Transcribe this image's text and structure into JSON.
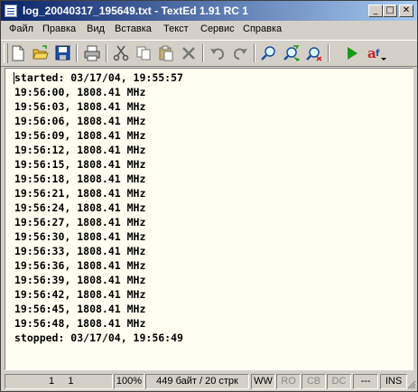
{
  "window": {
    "title": "log_20040317_195649.txt - TextEd 1.91 RC 1",
    "controls": {
      "minimize": "_",
      "maximize": "□",
      "close": "✕"
    }
  },
  "menu": [
    "Файл",
    "Правка",
    "Вид",
    "Вставка",
    "Текст",
    "Сервис",
    "Справка"
  ],
  "toolbar": {
    "icons": [
      "new-file-icon",
      "open-folder-icon",
      "save-icon",
      "print-icon",
      "cut-icon",
      "copy-icon",
      "paste-icon",
      "delete-icon",
      "undo-icon",
      "redo-icon",
      "find-icon",
      "find-next-icon",
      "replace-icon",
      "run-icon",
      "font-icon"
    ],
    "colors": {
      "green": "#1a9a1a",
      "red": "#d42020",
      "blue": "#1c4ea3",
      "yellow": "#e8c030"
    }
  },
  "editor": {
    "lines": [
      "started: 03/17/04, 19:55:57",
      "19:56:00, 1808.41 MHz",
      "19:56:03, 1808.41 MHz",
      "19:56:06, 1808.41 MHz",
      "19:56:09, 1808.41 MHz",
      "19:56:12, 1808.41 MHz",
      "19:56:15, 1808.41 MHz",
      "19:56:18, 1808.41 MHz",
      "19:56:21, 1808.41 MHz",
      "19:56:24, 1808.41 MHz",
      "19:56:27, 1808.41 MHz",
      "19:56:30, 1808.41 MHz",
      "19:56:33, 1808.41 MHz",
      "19:56:36, 1808.41 MHz",
      "19:56:39, 1808.41 MHz",
      "19:56:42, 1808.41 MHz",
      "19:56:45, 1808.41 MHz",
      "19:56:48, 1808.41 MHz",
      "stopped: 03/17/04, 19:56:49"
    ],
    "background": "#fffef0"
  },
  "status": {
    "position": "1     1",
    "zoom": "100%",
    "info": "449 байт / 20 стрк",
    "ww": "WW",
    "ro": "RO",
    "cb": "CB",
    "dc": "DC",
    "dots": "---",
    "ins": "INS"
  }
}
